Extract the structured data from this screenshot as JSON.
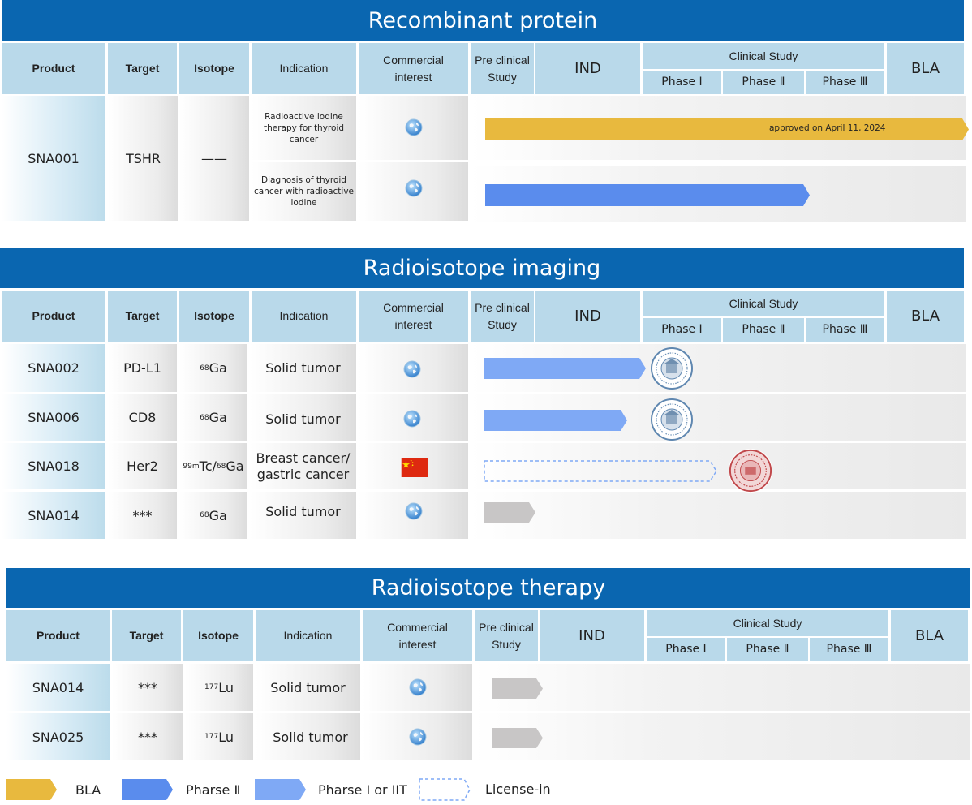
{
  "colors": {
    "title_bg": "#0a66b0",
    "header_bg": "#b9d9ea",
    "bla": "#e8b93e",
    "phase2": "#5a8ced",
    "phase1_iit": "#7fa9f5",
    "license_in": "#7fa9f5",
    "preclinical": "#c8c6c6"
  },
  "headers": {
    "product": "Product",
    "target": "Target",
    "isotope": "Isotope",
    "indication": "Indication",
    "commercial_1": "Commercial",
    "commercial_2": "interest",
    "preclinical_1": "Pre clinical",
    "preclinical_2": "Study",
    "ind": "IND",
    "clinical": "Clinical Study",
    "phase1": "Phase Ⅰ",
    "phase2": "Phase Ⅱ",
    "phase3": "Phase Ⅲ",
    "bla": "BLA"
  },
  "sections": [
    {
      "title": "Recombinant protein",
      "product": "SNA001",
      "target": "TSHR",
      "isotope": "——",
      "rows": [
        {
          "indication": "Radioactive iodine therapy for thyroid cancer",
          "interest_icon": "globe-icon",
          "bar": "bla",
          "bar_label": "approved on April 11, 2024"
        },
        {
          "indication": "Diagnosis of thyroid cancer with radioactive iodine",
          "interest_icon": "globe-icon",
          "bar": "phase2"
        }
      ]
    },
    {
      "title": "Radioisotope imaging",
      "rows": [
        {
          "product": "SNA002",
          "target": "PD-L1",
          "isotope_mass": "68",
          "isotope_el": "Ga",
          "indication": "Solid tumor",
          "interest_icon": "globe-icon",
          "bar": "phase1_iit",
          "seal": "blue-university-seal-icon"
        },
        {
          "product": "SNA006",
          "target": "CD8",
          "isotope_mass": "68",
          "isotope_el": "Ga",
          "indication": "Solid tumor",
          "interest_icon": "globe-icon",
          "bar": "phase1_iit",
          "seal": "blue-university-seal-icon"
        },
        {
          "product": "SNA018",
          "target": "Her2",
          "isotope_mass": "99m",
          "isotope_el": "Tc/",
          "isotope_mass2": "68",
          "isotope_el2": "Ga",
          "indication_1": "Breast cancer/",
          "indication_2": "gastric cancer",
          "interest_icon": "china-flag-icon",
          "bar": "license_in",
          "seal": "red-university-seal-icon"
        },
        {
          "product": "SNA014",
          "target": "***",
          "isotope_mass": "68",
          "isotope_el": "Ga",
          "indication": "Solid tumor",
          "interest_icon": "globe-icon",
          "bar": "preclinical"
        }
      ]
    },
    {
      "title": "Radioisotope therapy",
      "rows": [
        {
          "product": "SNA014",
          "target": "***",
          "isotope_mass": "177",
          "isotope_el": "Lu",
          "indication": "Solid tumor",
          "interest_icon": "globe-icon",
          "bar": "preclinical"
        },
        {
          "product": "SNA025",
          "target": "***",
          "isotope_mass": "177",
          "isotope_el": "Lu",
          "indication": "Solid tumor",
          "interest_icon": "globe-icon",
          "bar": "preclinical"
        }
      ]
    }
  ],
  "legend": [
    {
      "label": "BLA",
      "style": "bla"
    },
    {
      "label": "Pharse Ⅱ",
      "style": "phase2"
    },
    {
      "label": "Pharse Ⅰ or IIT",
      "style": "phase1_iit"
    },
    {
      "label": "License-in",
      "style": "license_in"
    }
  ]
}
